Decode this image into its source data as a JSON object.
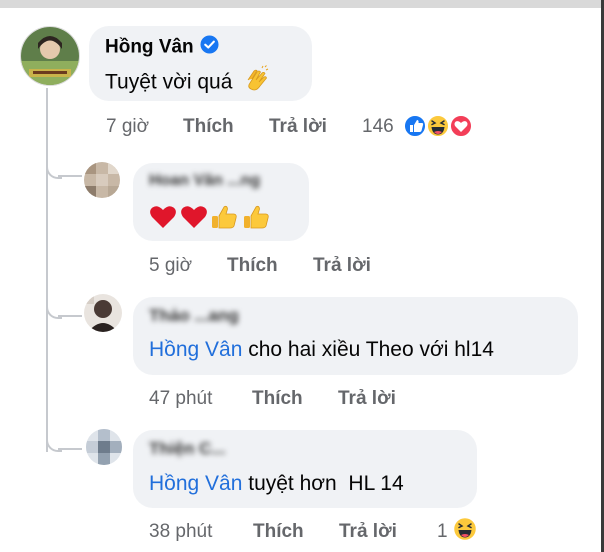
{
  "comments": [
    {
      "author": "Hồng Vân",
      "verified": true,
      "text": "Tuyệt vời quá",
      "emoji": "clapping-hands",
      "time": "7 giờ",
      "like_label": "Thích",
      "reply_label": "Trả lời",
      "reaction_count": "146",
      "reactions": [
        "like",
        "haha",
        "love"
      ]
    },
    {
      "author": "Hoan Văn ...ng",
      "author_blurred": true,
      "text": "",
      "emoji_sequence": [
        "heart",
        "heart",
        "thumbs-up",
        "thumbs-up"
      ],
      "time": "5 giờ",
      "like_label": "Thích",
      "reply_label": "Trả lời"
    },
    {
      "author": "Thảo ...ang",
      "author_blurred": true,
      "mention": "Hồng Vân",
      "text": " cho hai xiều Theo với hl14",
      "time": "47 phút",
      "like_label": "Thích",
      "reply_label": "Trả lời"
    },
    {
      "author": "Thiện C...",
      "author_blurred": true,
      "mention": "Hồng Vân",
      "text": " tuyệt hơn  HL 14",
      "time": "38 phút",
      "like_label": "Thích",
      "reply_label": "Trả lời",
      "reaction_count": "1",
      "reactions": [
        "haha"
      ]
    }
  ],
  "colors": {
    "bubble": "#f0f2f5",
    "mention": "#216fdb",
    "meta": "#65676b",
    "verified": "#1877f2"
  }
}
